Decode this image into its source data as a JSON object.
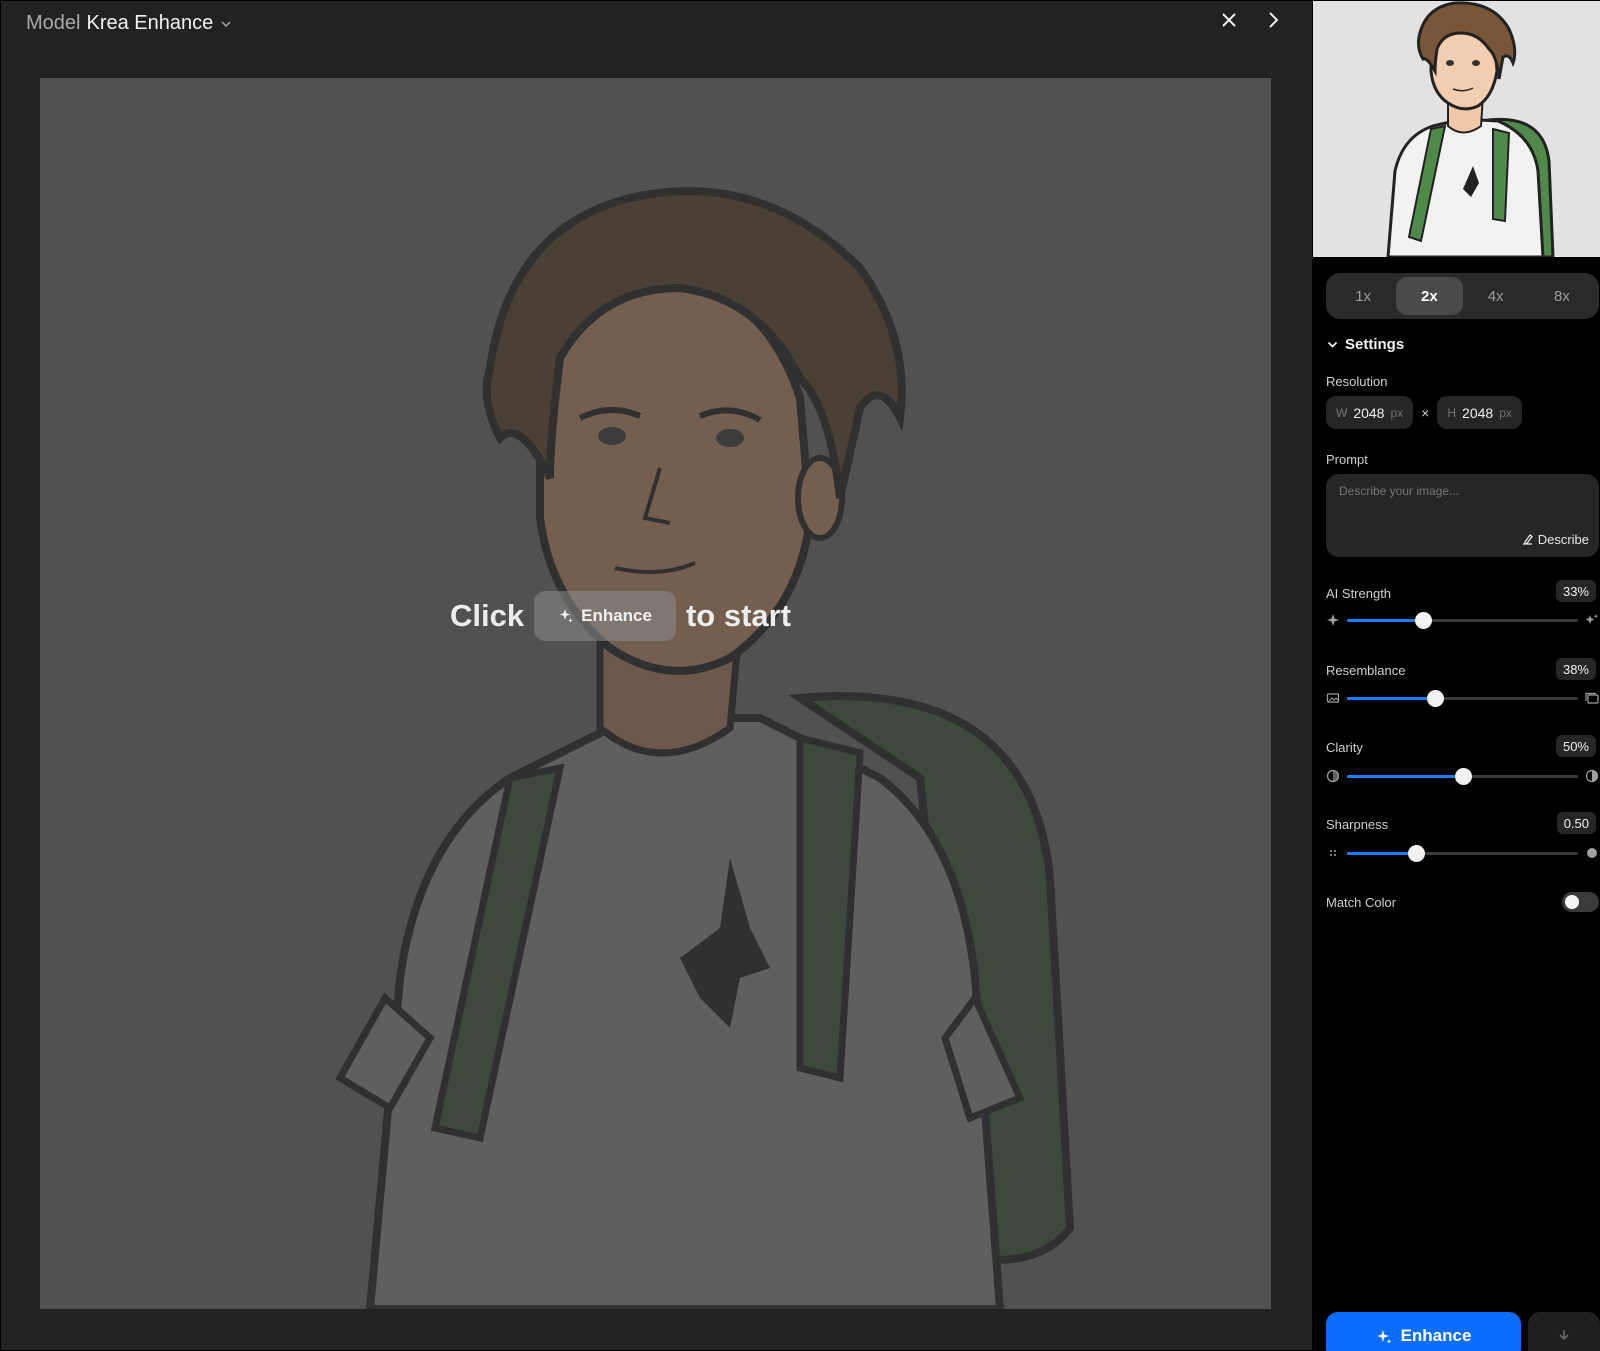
{
  "header": {
    "model_label": "Model",
    "model_name": "Krea Enhance"
  },
  "cta": {
    "before": "Click",
    "button_label": "Enhance",
    "after": "to start"
  },
  "scale": {
    "options": [
      "1x",
      "2x",
      "4x",
      "8x"
    ],
    "selected": "2x"
  },
  "settings": {
    "title": "Settings",
    "resolution": {
      "label": "Resolution",
      "width_key": "W",
      "width": "2048",
      "height_key": "H",
      "height": "2048",
      "unit": "px",
      "separator": "×"
    },
    "prompt": {
      "label": "Prompt",
      "placeholder": "Describe your image...",
      "describe_label": "Describe"
    },
    "sliders": [
      {
        "label": "AI Strength",
        "display": "33%",
        "value": 0.33
      },
      {
        "label": "Resemblance",
        "display": "38%",
        "value": 0.38
      },
      {
        "label": "Clarity",
        "display": "50%",
        "value": 0.5
      },
      {
        "label": "Sharpness",
        "display": "0.50",
        "value": 0.3
      }
    ],
    "match_color": {
      "label": "Match Color",
      "on": false
    }
  },
  "actions": {
    "enhance_label": "Enhance"
  },
  "colors": {
    "accent": "#0c6dff",
    "panel_bg": "#000000",
    "canvas_bg": "#222222"
  }
}
